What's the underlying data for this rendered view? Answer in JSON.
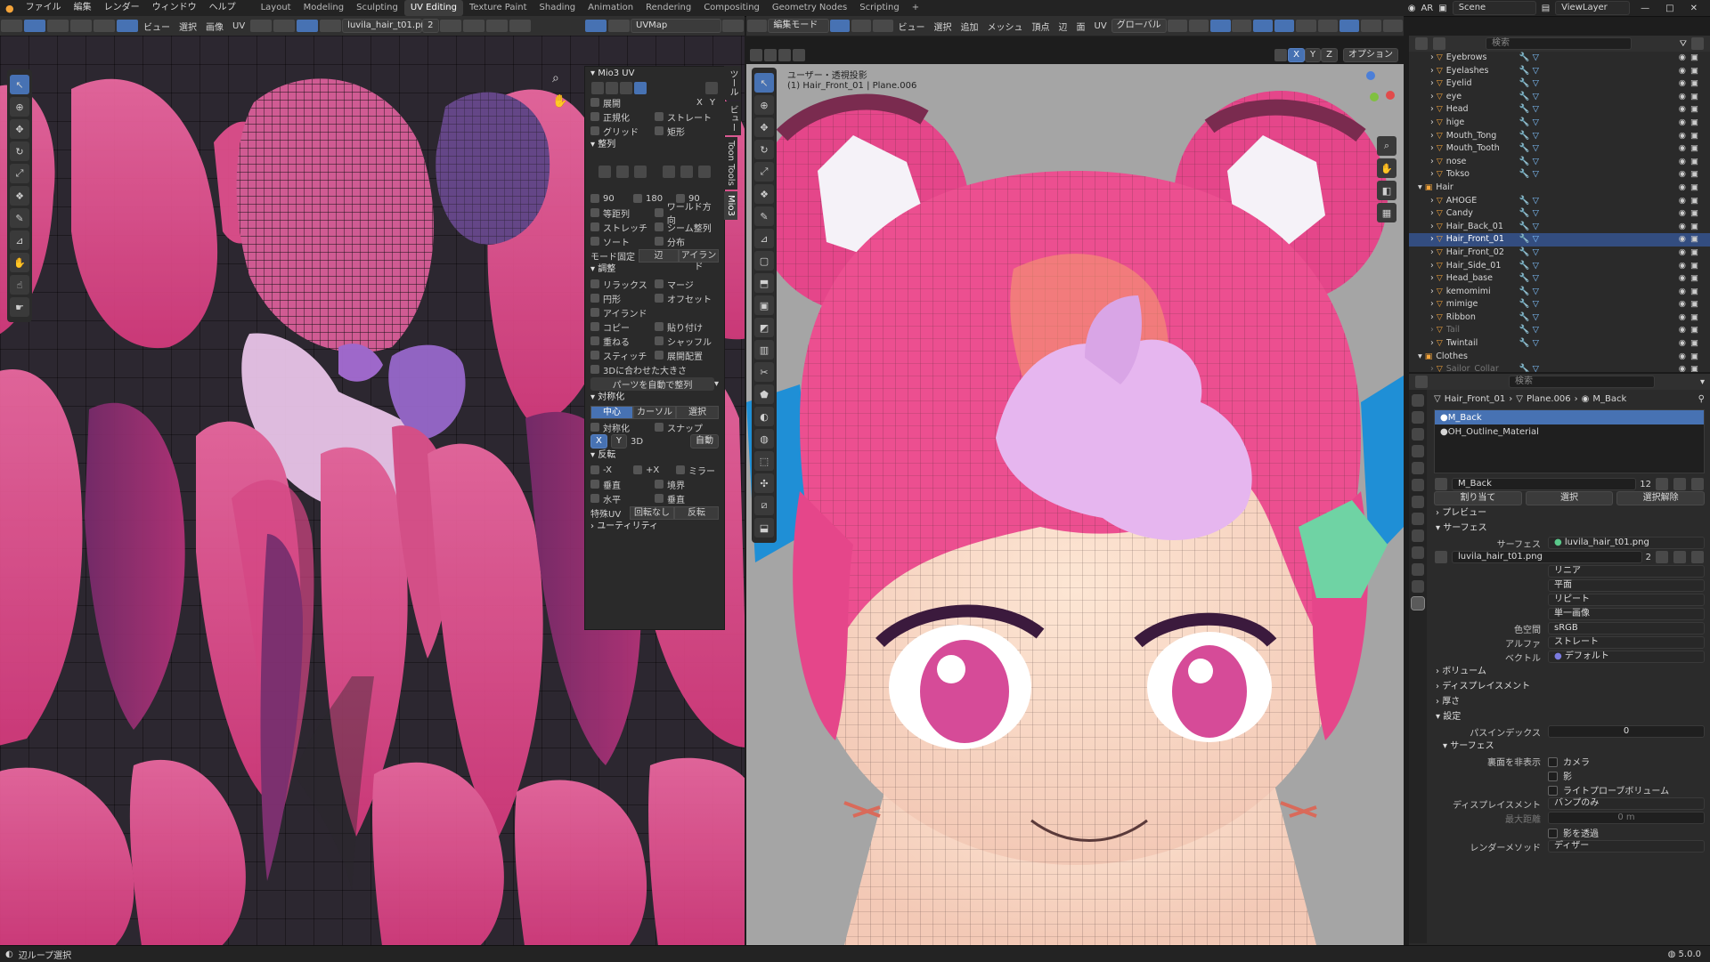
{
  "topbar": {
    "menu": [
      "ファイル",
      "編集",
      "レンダー",
      "ウィンドウ",
      "ヘルプ"
    ],
    "workspaces": [
      "Layout",
      "Modeling",
      "Sculpting",
      "UV Editing",
      "Texture Paint",
      "Shading",
      "Animation",
      "Rendering",
      "Compositing",
      "Geometry Nodes",
      "Scripting"
    ],
    "active_workspace": "UV Editing",
    "lang": "AR",
    "scene": "Scene",
    "view_layer": "ViewLayer"
  },
  "uv_header": {
    "menu": [
      "ビュー",
      "選択",
      "画像",
      "UV"
    ],
    "image_name": "luvila_hair_t01.png",
    "image_users": "2",
    "uvmap": "UVMap"
  },
  "mio": {
    "title": "Mio3 UV",
    "unwrap": "展開",
    "unwrap_axes": [
      "X",
      "Y"
    ],
    "normalize": "正規化",
    "straight": "ストレート",
    "grid": "グリッド",
    "rect": "矩形",
    "align_section": "整列",
    "rot_values": [
      "90",
      "180",
      "90"
    ],
    "reorder": "等距列",
    "world_dir": "ワールド方向",
    "stretch": "ストレッチ",
    "seam_align": "シーム整列",
    "sort": "ソート",
    "distribute": "分布",
    "mode_label": "モード固定",
    "mode_edge": "辺",
    "mode_island": "アイランド",
    "adjust_section": "調整",
    "relax": "リラックス",
    "merge": "マージ",
    "circle": "円形",
    "offset": "オフセット",
    "island_label": "アイランド",
    "copy": "コピー",
    "paste": "貼り付け",
    "stack": "重ねる",
    "shuffle": "シャッフル",
    "stitch": "スティッチ",
    "rearrange": "展開配置",
    "match3d": "3Dに合わせた大きさ",
    "auto_align": "パーツを自動で整列",
    "symmetry_section": "対称化",
    "center": "中心",
    "cursor": "カーソル",
    "selection": "選択",
    "symmetrize": "対称化",
    "snap": "スナップ",
    "sym_x": "X",
    "sym_y": "Y",
    "sym_3d": "3D",
    "sym_auto": "自動",
    "flip_section": "反転",
    "neg_x": "-X",
    "pos_x": "+X",
    "mirror": "ミラー",
    "vertical": "垂直",
    "border": "境界",
    "horizontal": "水平",
    "up": "垂直",
    "special_uv": "特殊UV",
    "no_rotate": "回転なし",
    "reverse": "反転",
    "utility": "ユーティリティ",
    "side_tabs": [
      "ツール",
      "ビュー",
      "Toon Tools",
      "Mio3"
    ]
  },
  "viewport": {
    "mode": "編集モード",
    "menu": [
      "ビュー",
      "選択",
      "追加",
      "メッシュ",
      "頂点",
      "辺",
      "面",
      "UV"
    ],
    "transform": "グローバル",
    "overlay_title": "ユーザー・透視投影",
    "overlay_sub": "(1) Hair_Front_01 | Plane.006",
    "options": "オプション",
    "axes": [
      "X",
      "Y",
      "Z"
    ]
  },
  "outliner": {
    "search_placeholder": "検索",
    "items": [
      {
        "name": "Eyebrows",
        "indent": 1,
        "selected": false,
        "disabled": false
      },
      {
        "name": "Eyelashes",
        "indent": 1,
        "selected": false,
        "disabled": false
      },
      {
        "name": "Eyelid",
        "indent": 1,
        "selected": false,
        "disabled": false
      },
      {
        "name": "eye",
        "indent": 1,
        "selected": false,
        "disabled": false
      },
      {
        "name": "Head",
        "indent": 1,
        "selected": false,
        "disabled": false
      },
      {
        "name": "hige",
        "indent": 1,
        "selected": false,
        "disabled": false
      },
      {
        "name": "Mouth_Tong",
        "indent": 1,
        "selected": false,
        "disabled": false
      },
      {
        "name": "Mouth_Tooth",
        "indent": 1,
        "selected": false,
        "disabled": false
      },
      {
        "name": "nose",
        "indent": 1,
        "selected": false,
        "disabled": false
      },
      {
        "name": "Tokso",
        "indent": 1,
        "selected": false,
        "disabled": false
      },
      {
        "name": "Hair",
        "indent": 0,
        "selected": false,
        "disabled": false
      },
      {
        "name": "AHOGE",
        "indent": 1,
        "selected": false,
        "disabled": false
      },
      {
        "name": "Candy",
        "indent": 1,
        "selected": false,
        "disabled": false
      },
      {
        "name": "Hair_Back_01",
        "indent": 1,
        "selected": false,
        "disabled": false
      },
      {
        "name": "Hair_Front_01",
        "indent": 1,
        "selected": true,
        "disabled": false
      },
      {
        "name": "Hair_Front_02",
        "indent": 1,
        "selected": false,
        "disabled": false
      },
      {
        "name": "Hair_Side_01",
        "indent": 1,
        "selected": false,
        "disabled": false
      },
      {
        "name": "Head_base",
        "indent": 1,
        "selected": false,
        "disabled": false
      },
      {
        "name": "kemomimi",
        "indent": 1,
        "selected": false,
        "disabled": false
      },
      {
        "name": "mimige",
        "indent": 1,
        "selected": false,
        "disabled": false
      },
      {
        "name": "Ribbon",
        "indent": 1,
        "selected": false,
        "disabled": false
      },
      {
        "name": "Tail",
        "indent": 1,
        "selected": false,
        "disabled": true
      },
      {
        "name": "Twintail",
        "indent": 1,
        "selected": false,
        "disabled": false
      },
      {
        "name": "Clothes",
        "indent": 0,
        "selected": false,
        "disabled": false
      },
      {
        "name": "Sailor_Collar",
        "indent": 1,
        "selected": false,
        "disabled": true
      }
    ]
  },
  "props": {
    "search_placeholder": "検索",
    "crumb_obj": "Hair_Front_01",
    "crumb_mesh": "Plane.006",
    "crumb_mat": "M_Back",
    "slots": [
      "M_Back",
      "OH_Outline_Material"
    ],
    "material_name": "M_Back",
    "users": "12",
    "assign": "割り当て",
    "select": "選択",
    "deselect": "選択解除",
    "preview": "プレビュー",
    "surface": "サーフェス",
    "surface_label": "サーフェス",
    "surface_value": "luvila_hair_t01.png",
    "tex_name": "luvila_hair_t01.png",
    "tex_users": "2",
    "interp": "リニア",
    "proj": "平面",
    "ext": "リピート",
    "source": "単一画像",
    "colorspace_label": "色空間",
    "colorspace": "sRGB",
    "alpha_label": "アルファ",
    "alpha": "ストレート",
    "vector_label": "ベクトル",
    "vector": "デフォルト",
    "volume": "ボリューム",
    "displacement": "ディスプレイスメント",
    "thickness": "厚さ",
    "settings": "設定",
    "pass_index_label": "パスインデックス",
    "pass_index": "0",
    "surface_sub": "サーフェス",
    "backface_label": "裏面を非表示",
    "camera": "カメラ",
    "shadow": "影",
    "lightprobe": "ライトプローブボリューム",
    "disp_label": "ディスプレイスメント",
    "disp_value": "バンプのみ",
    "max_dist_label": "最大距離",
    "max_dist": "0 m",
    "transparent_shadow": "影を透過",
    "render_method_label": "レンダーメソッド",
    "render_method": "ディザー"
  },
  "status": {
    "left": "辺ループ選択",
    "version": "5.0.0"
  },
  "colors": {
    "accent": "#4772b3",
    "hair_pink": "#e8468a",
    "select_orange": "#f4a43a"
  }
}
